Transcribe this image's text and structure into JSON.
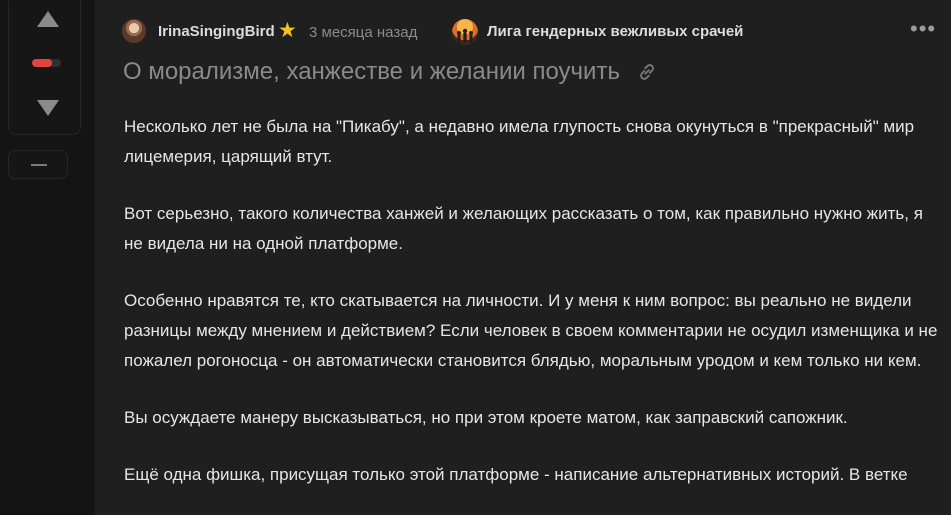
{
  "vote": {
    "rating_negative_fraction": 0.7,
    "rating_color": "#e2453c"
  },
  "post": {
    "author": "IrinaSingingBird",
    "author_badge_icon": "star-icon",
    "time": "3 месяца назад",
    "community": "Лига гендерных вежливых срачей",
    "title": "О морализме, ханжестве и желании поучить",
    "paragraphs": [
      "Несколько лет не была на \"Пикабу\", а недавно имела глупость снова окунуться в \"прекрасный\" мир лицемерия, царящий втут.",
      "Вот серьезно, такого количества ханжей и желающих рассказать о том, как правильно нужно жить, я не видела ни на одной платформе.",
      "Особенно нравятся те, кто скатывается на личности. И у меня к ним вопрос: вы реально не видели разницы между мнением и действием? Если человек в своем комментарии не осудил изменщика и не пожалел рогоносца - он автоматически становится блядью, моральным уродом и кем только ни кем.",
      "Вы осуждаете манеру высказываться, но при этом кроете матом, как заправский сапожник.",
      "Ещё одна фишка, присущая только этой платформе - написание альтернативных историй. В ветке"
    ]
  },
  "colors": {
    "background": "#141414",
    "card": "#1f1f1f",
    "text": "#e6e6e6",
    "muted": "#8b8b8b",
    "title": "#8a8a8a",
    "star": "#f4c21f"
  }
}
